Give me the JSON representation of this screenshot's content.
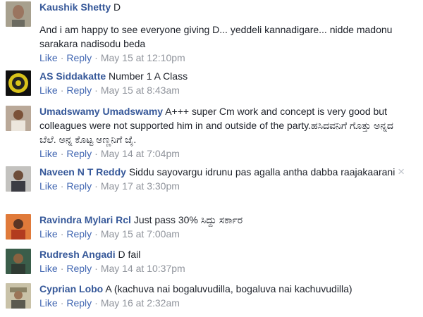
{
  "comments": [
    {
      "author": "Kaushik Shetty",
      "text": "D",
      "text2": "And i am happy to see everyone giving D... yeddeli kannadigare... nidde madonu sarakara nadisodu beda",
      "like": "Like",
      "reply": "Reply",
      "time": "May 15 at 12:10pm"
    },
    {
      "author": "AS Siddakatte",
      "text": "Number 1 A Class",
      "like": "Like",
      "reply": "Reply",
      "time": "May 15 at 8:43am"
    },
    {
      "author": "Umadswamy Umadswamy",
      "text": "A+++ super Cm work and concept is very good but colleagues were not supported him in and outside of the party.ಹಸಿದವನಿಗೆ ಗೊತ್ತು ಅನ್ನದ ಬೆಲೆ. ಅನ್ನ ಕೊಟ್ಟ ಅಣ್ಣನಿಗೆ ಜೈ.",
      "like": "Like",
      "reply": "Reply",
      "time": "May 14 at 7:04pm"
    },
    {
      "author": "Naveen N T Reddy",
      "text": "Siddu sayovargu idrunu pas agalla antha dabba raajakaarani",
      "like": "Like",
      "reply": "Reply",
      "time": "May 17 at 3:30pm"
    },
    {
      "author": "Ravindra Mylari Rcl",
      "text": "Just pass 30% ಸಿದ್ದು ಸರ್ಕಾರ",
      "like": "Like",
      "reply": "Reply",
      "time": "May 15 at 7:00am"
    },
    {
      "author": "Rudresh Angadi",
      "text": "D fail",
      "like": "Like",
      "reply": "Reply",
      "time": "May 14 at 10:37pm"
    },
    {
      "author": "Cyprian Lobo",
      "text": "A (kachuva nai bogaluvudilla, bogaluva nai kachuvudilla)",
      "like": "Like",
      "reply": "Reply",
      "time": "May 16 at 2:32am"
    }
  ],
  "dot": "·",
  "close_icon": "×"
}
